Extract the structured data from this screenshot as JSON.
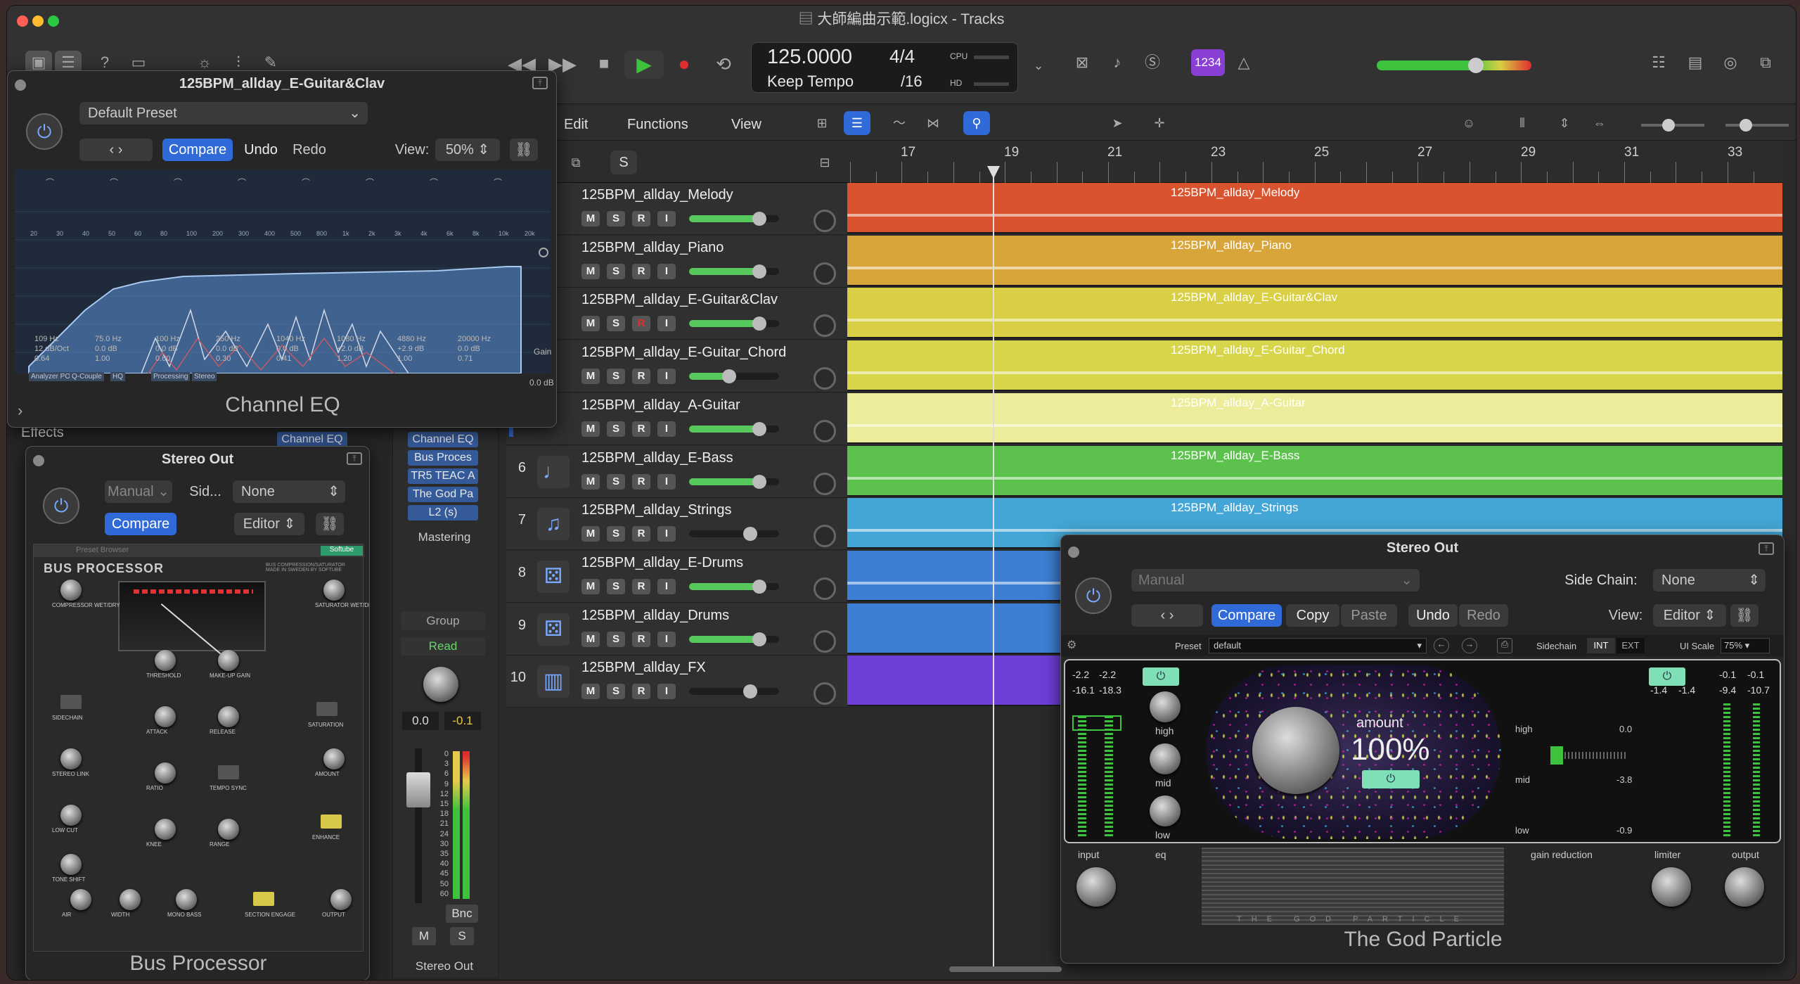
{
  "window": {
    "title": "大師編曲示範.logicx - Tracks"
  },
  "lcd": {
    "tempo": "125.0000",
    "tempo_mode": "Keep Tempo",
    "sig_top": "4/4",
    "sig_bottom": "/16",
    "cpu": "CPU",
    "hd": "HD"
  },
  "toolbar": {
    "badge": "1234"
  },
  "menus": {
    "edit": "Edit",
    "functions": "Functions",
    "view": "View"
  },
  "header_btn": {
    "s": "S"
  },
  "ruler": [
    "17",
    "19",
    "21",
    "23",
    "25",
    "27",
    "29",
    "31",
    "33"
  ],
  "tracks": [
    {
      "num": "",
      "name": "125BPM_allday_Melody",
      "color": "#d9532e",
      "m": "M",
      "s": "S",
      "r": "R",
      "i": "I",
      "vol": 0.78,
      "region": "125BPM_allday_Melody"
    },
    {
      "num": "",
      "name": "125BPM_allday_Piano",
      "color": "#d8a53a",
      "m": "M",
      "s": "S",
      "r": "R",
      "i": "I",
      "vol": 0.78,
      "region": "125BPM_allday_Piano"
    },
    {
      "num": "",
      "name": "125BPM_allday_E-Guitar&Clav",
      "color": "#d8cf45",
      "m": "M",
      "s": "S",
      "r": "R",
      "i": "I",
      "vol": 0.78,
      "region": "125BPM_allday_E-Guitar&Clav"
    },
    {
      "num": "",
      "name": "125BPM_allday_E-Guitar_Chord",
      "color": "#d7d64a",
      "m": "M",
      "s": "S",
      "r": "R",
      "i": "I",
      "vol": 0.45,
      "region": "125BPM_allday_E-Guitar_Chord"
    },
    {
      "num": "",
      "name": "125BPM_allday_A-Guitar",
      "color": "#ecec9a",
      "m": "M",
      "s": "S",
      "r": "R",
      "i": "I",
      "vol": 0.78,
      "region": "125BPM_allday_A-Guitar"
    },
    {
      "num": "6",
      "name": "125BPM_allday_E-Bass",
      "color": "#5cc24d",
      "m": "M",
      "s": "S",
      "r": "R",
      "i": "I",
      "vol": 0.78,
      "region": "125BPM_allday_E-Bass"
    },
    {
      "num": "7",
      "name": "125BPM_allday_Strings",
      "color": "#43a6d6",
      "m": "M",
      "s": "S",
      "r": "R",
      "i": "I",
      "vol": 0.0,
      "region": "125BPM_allday_Strings"
    },
    {
      "num": "8",
      "name": "125BPM_allday_E-Drums",
      "color": "#3d7fd4",
      "m": "M",
      "s": "S",
      "r": "R",
      "i": "I",
      "vol": 0.78,
      "region": ""
    },
    {
      "num": "9",
      "name": "125BPM_allday_Drums",
      "color": "#3d7fd4",
      "m": "M",
      "s": "S",
      "r": "R",
      "i": "I",
      "vol": 0.78,
      "region": ""
    },
    {
      "num": "10",
      "name": "125BPM_allday_FX",
      "color": "#6e3fd8",
      "m": "M",
      "s": "S",
      "r": "R",
      "i": "I",
      "vol": 0.0,
      "region": ""
    }
  ],
  "eq": {
    "title": "125BPM_allday_E-Guitar&Clav",
    "preset": "Default Preset",
    "compare": "Compare",
    "undo": "Undo",
    "redo": "Redo",
    "view_label": "View:",
    "view_value": "50%",
    "footer": "Channel EQ",
    "freqs": [
      "109 Hz",
      "75.0 Hz",
      "100 Hz",
      "250 Hz",
      "1040 Hz",
      "1080 Hz",
      "4880 Hz",
      "20000 Hz"
    ],
    "gains": [
      "12 dB/Oct",
      "0.0 dB",
      "0.0 dB",
      "0.0 dB",
      "0.0 dB",
      "+2.0 dB",
      "+2.9 dB",
      "0.0 dB"
    ],
    "qs": [
      "0.64",
      "1.00",
      "0.60",
      "0.30",
      "0.41",
      "1.20",
      "1.00",
      "0.71"
    ],
    "gain_label": "Gain",
    "gain_value": "0.0 dB",
    "bottom": [
      "Analyzer POST",
      "Q-Couple",
      "HQ",
      "Processing",
      "Stereo"
    ],
    "axis": [
      "20",
      "30",
      "40",
      "50",
      "60",
      "80",
      "100",
      "200",
      "300",
      "400",
      "500",
      "800",
      "1k",
      "2k",
      "3k",
      "4k",
      "6k",
      "8k",
      "10k",
      "20k"
    ]
  },
  "inspector": {
    "effects": "Effects",
    "channel_eq": "Channel EQ"
  },
  "bus": {
    "title": "Stereo Out",
    "preset": "Manual",
    "side_label": "Sid...",
    "side_value": "None",
    "compare": "Compare",
    "view": "Editor",
    "footer": "Bus Processor",
    "brand": "BUS PROCESSOR",
    "subtitle": "BUS COMPRESSION/SATURATOR MADE IN SWEDEN BY SOFTUBE",
    "softube": "Softube",
    "preset_browser": "Preset Browser",
    "labels": [
      "COMPRESSOR WET/DRY",
      "THRESHOLD",
      "MAKE-UP GAIN",
      "SATURATOR WET/DRY",
      "SIDECHAIN",
      "STEREO LINK",
      "ATTACK",
      "RELEASE",
      "SATURATION",
      "AMOUNT",
      "LOW CUT",
      "ENHANCE",
      "RATIO",
      "TEMPO SYNC",
      "TONE SHIFT",
      "KNEE",
      "RANGE",
      "AIR",
      "WIDTH",
      "MONO BASS",
      "SECTION ENGAGE",
      "OUTPUT"
    ]
  },
  "mixer": {
    "inserts": [
      "Channel EQ",
      "Bus Proces",
      "TR5 TEAC A",
      "The God Pa",
      "L2 (s)"
    ],
    "mastering": "Mastering",
    "group": "Group",
    "read": "Read",
    "val1": "0.0",
    "val2": "-0.1",
    "bnc": "Bnc",
    "m": "M",
    "s": "S",
    "name": "Stereo Out",
    "scale": [
      "0",
      "3",
      "6",
      "9",
      "12",
      "15",
      "18",
      "21",
      "24",
      "30",
      "35",
      "40",
      "45",
      "50",
      "60"
    ]
  },
  "god": {
    "title": "Stereo Out",
    "preset": "Manual",
    "side_label": "Side Chain:",
    "side_value": "None",
    "compare": "Copy",
    "compare_btn": "Compare",
    "paste": "Paste",
    "undo": "Undo",
    "redo": "Redo",
    "view_label": "View:",
    "view_value": "Editor",
    "preset_label": "Preset",
    "preset_value": "default",
    "sidechain": "Sidechain",
    "int": "INT",
    "ext": "EXT",
    "uiscale": "UI Scale",
    "uiscale_value": "75%",
    "meters_l": [
      "-2.2",
      "-2.2",
      "-16.1",
      "-18.3"
    ],
    "meters_r": [
      "-0.1",
      "-0.1",
      "-9.4",
      "-10.7"
    ],
    "mid_r": [
      "-1.4",
      "-1.4"
    ],
    "bands": [
      "high",
      "mid",
      "low"
    ],
    "amount_label": "amount",
    "amount": "100%",
    "gr_high": "0.0",
    "gr_mid": "-3.8",
    "gr_low": "-0.9",
    "bottom": [
      "input",
      "eq",
      "gain reduction",
      "limiter",
      "output"
    ],
    "footer": "The God Particle",
    "brand": "THE GOD PARTICLE"
  },
  "colors": {
    "accent": "#2f6ad8",
    "play": "#3cc23c",
    "record": "#e02d2d",
    "badge": "#8a3fd4"
  }
}
